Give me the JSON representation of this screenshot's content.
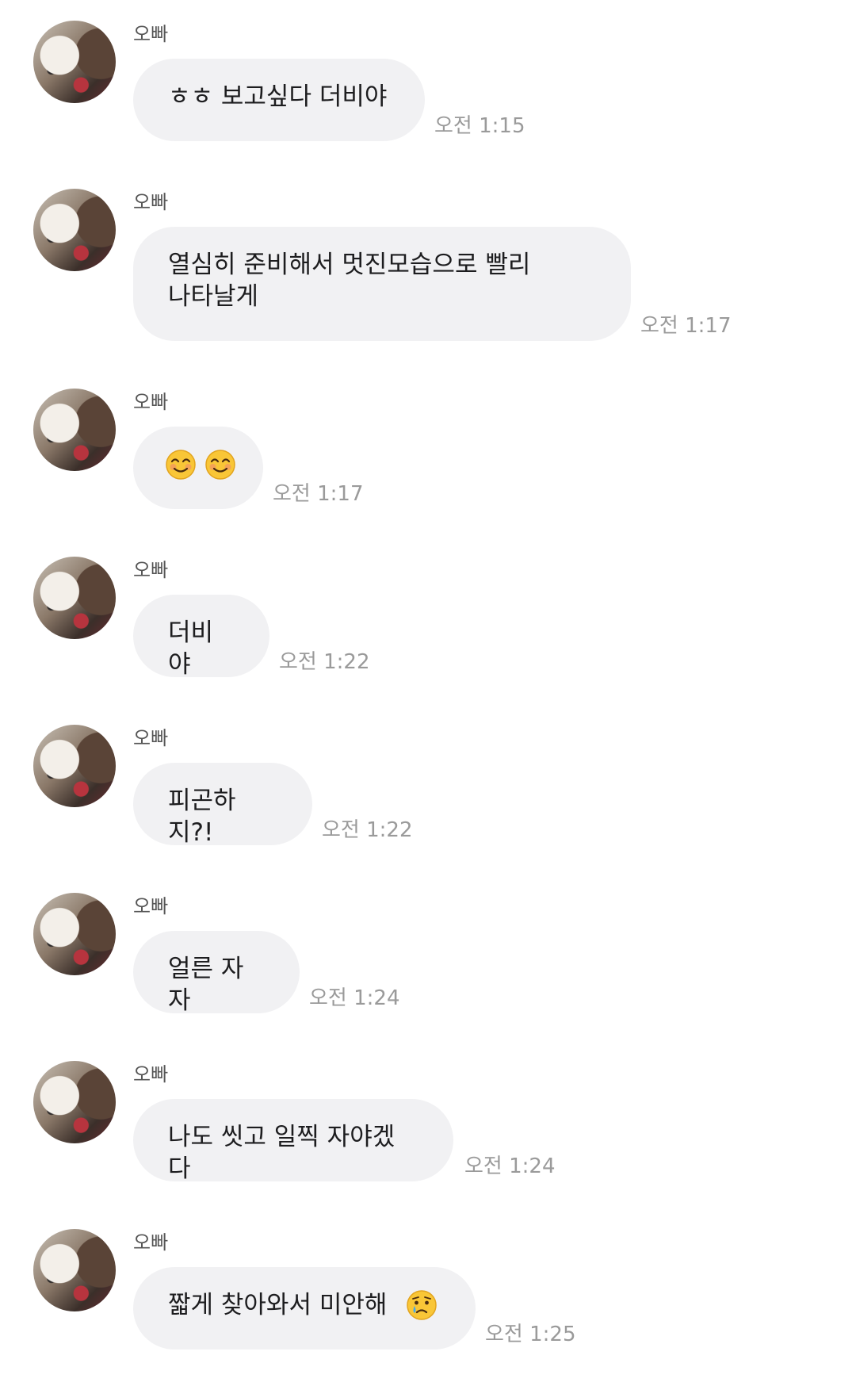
{
  "messages": [
    {
      "sender": "오빠",
      "text": "ㅎㅎ 보고싶다 더비야",
      "time": "오전 1:15"
    },
    {
      "sender": "오빠",
      "text": "열심히 준비해서 멋진모습으로 빨리",
      "text2": "나타날게",
      "time": "오전 1:17"
    },
    {
      "sender": "오빠",
      "emojis": [
        "smiling-face-emoji",
        "smiling-face-emoji"
      ],
      "time": "오전 1:17"
    },
    {
      "sender": "오빠",
      "text": "더비야",
      "time": "오전 1:22"
    },
    {
      "sender": "오빠",
      "text": "피곤하지?!",
      "time": "오전 1:22"
    },
    {
      "sender": "오빠",
      "text": "얼른 자자",
      "time": "오전 1:24"
    },
    {
      "sender": "오빠",
      "text": "나도 씻고 일찍 자야겠다",
      "time": "오전 1:24"
    },
    {
      "sender": "오빠",
      "text": "짧게 찾아와서 미안해",
      "emojis": [
        "crying-face-emoji"
      ],
      "time": "오전 1:25"
    }
  ]
}
